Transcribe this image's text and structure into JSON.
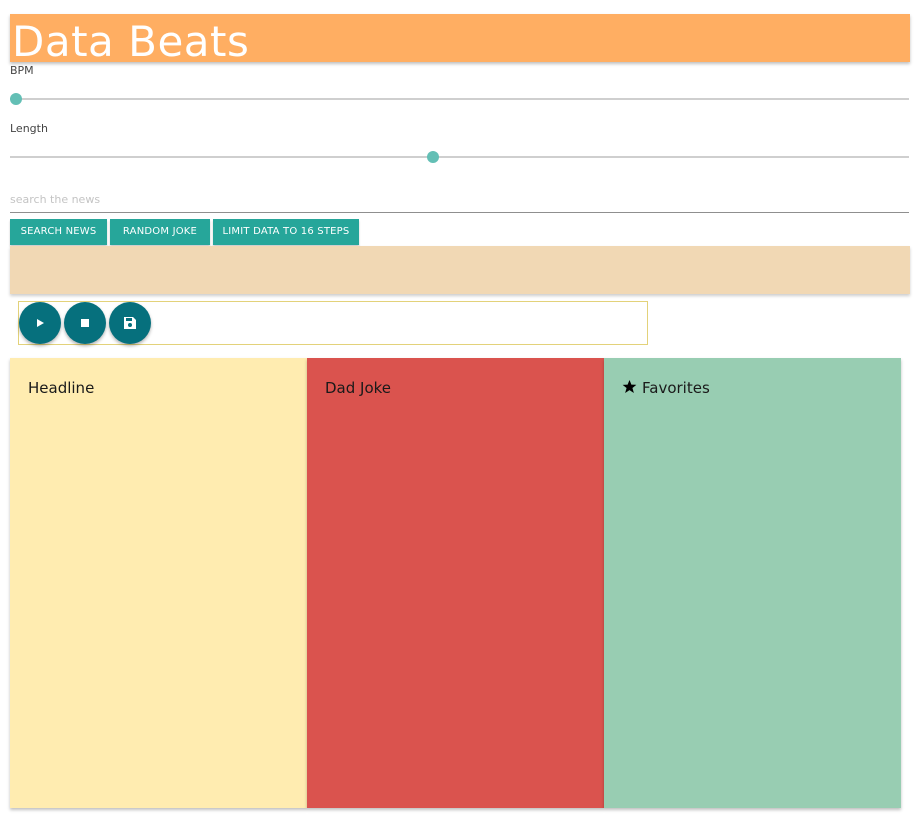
{
  "app": {
    "title": "Data Beats"
  },
  "controls": {
    "bpm": {
      "label": "BPM",
      "value_fraction": 0.0
    },
    "length": {
      "label": "Length",
      "value_fraction": 0.47
    }
  },
  "search": {
    "placeholder": "search the news",
    "value": ""
  },
  "buttons": {
    "search_news": "SEARCH NEWS",
    "random_joke": "RANDOM JOKE",
    "limit_data": "LIMIT DATA TO 16 STEPS"
  },
  "player": {
    "icons": [
      "play-icon",
      "stop-icon",
      "save-icon"
    ]
  },
  "panels": {
    "headline": {
      "title": "Headline",
      "color": "#ffecb0"
    },
    "dad_joke": {
      "title": "Dad Joke",
      "color": "#da534e"
    },
    "favorites": {
      "title": "Favorites",
      "icon": "star-icon",
      "color": "#98cdb2"
    }
  },
  "colors": {
    "header": "#ffae62",
    "button": "#26a69a",
    "slider_thumb": "#63bfb5",
    "circle_button": "#06707d",
    "beige_bar": "#f1d8b4"
  }
}
